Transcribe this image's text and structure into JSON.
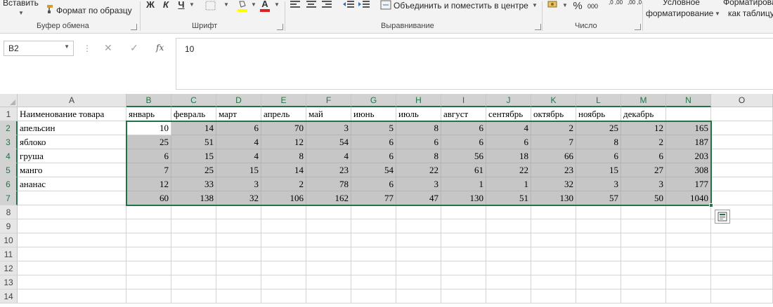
{
  "ribbon": {
    "paste_label": "Вставить",
    "format_painter_label": "Формат по образцу",
    "clipboard_group": "Буфер обмена",
    "bold": "Ж",
    "italic": "К",
    "underline": "Ч",
    "font_group": "Шрифт",
    "font_color_letter": "А",
    "merge_label": "Объединить и поместить в центре",
    "alignment_group": "Выравнивание",
    "percent": "%",
    "thousands": "000",
    "inc_decimal": ",0 ,00",
    "dec_decimal": ",00 ,0",
    "number_group": "Число",
    "cond_format_line1": "Условное",
    "cond_format_line2": "форматирование",
    "table_format_line1": "Форматирова",
    "table_format_line2": "как таблицу",
    "colors": {
      "highlight": "#ffff00",
      "font_color": "#e02020",
      "accent": "#217346"
    }
  },
  "formula_bar": {
    "name_box": "B2",
    "cancel_icon": "✕",
    "enter_icon": "✓",
    "fx_label": "fx",
    "formula": "10"
  },
  "columns": [
    "A",
    "B",
    "C",
    "D",
    "E",
    "F",
    "G",
    "H",
    "I",
    "J",
    "K",
    "L",
    "M",
    "N",
    "O"
  ],
  "rows": [
    "1",
    "2",
    "3",
    "4",
    "5",
    "6",
    "7",
    "8",
    "9",
    "10",
    "11",
    "12",
    "13",
    "14"
  ],
  "sheet": {
    "header_row": [
      "Наименование товара",
      "январь",
      "февраль",
      "март",
      "апрель",
      "май",
      "июнь",
      "июль",
      "август",
      "сентябрь",
      "октябрь",
      "ноябрь",
      "декабрь",
      ""
    ],
    "data_rows": [
      {
        "name": "апельсин",
        "values": [
          "10",
          "14",
          "6",
          "70",
          "3",
          "5",
          "8",
          "6",
          "4",
          "2",
          "25",
          "12",
          "165"
        ]
      },
      {
        "name": "яблоко",
        "values": [
          "25",
          "51",
          "4",
          "12",
          "54",
          "6",
          "6",
          "6",
          "6",
          "7",
          "8",
          "2",
          "187"
        ]
      },
      {
        "name": "груша",
        "values": [
          "6",
          "15",
          "4",
          "8",
          "4",
          "6",
          "8",
          "56",
          "18",
          "66",
          "6",
          "6",
          "203"
        ]
      },
      {
        "name": "манго",
        "values": [
          "7",
          "25",
          "15",
          "14",
          "23",
          "54",
          "22",
          "61",
          "22",
          "23",
          "15",
          "27",
          "308"
        ]
      },
      {
        "name": "ананас",
        "values": [
          "12",
          "33",
          "3",
          "2",
          "78",
          "6",
          "3",
          "1",
          "1",
          "32",
          "3",
          "3",
          "177"
        ]
      },
      {
        "name": "",
        "values": [
          "60",
          "138",
          "32",
          "106",
          "162",
          "77",
          "47",
          "130",
          "51",
          "130",
          "57",
          "50",
          "1040"
        ]
      }
    ]
  },
  "active_cell": "B2",
  "selection_range": "B2:N7",
  "quick_analysis_icon": "quick-analysis-icon"
}
